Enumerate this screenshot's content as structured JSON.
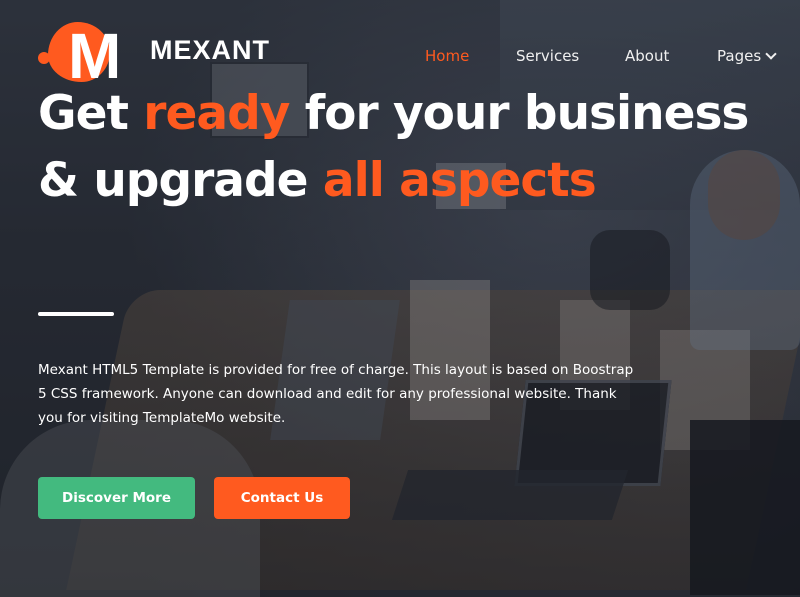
{
  "brand": {
    "name": "MEXANT",
    "mark_letter": "M",
    "accent_color": "#ff5a1f"
  },
  "nav": {
    "items": [
      {
        "label": "Home",
        "active": true
      },
      {
        "label": "Services"
      },
      {
        "label": "About"
      },
      {
        "label": "Pages",
        "icon": "chevron-down-icon"
      }
    ]
  },
  "hero": {
    "headline": {
      "part1": "Get ",
      "highlight1": "ready",
      "part2": " for your business",
      "part3": "& upgrade ",
      "highlight2": "all aspects"
    },
    "description": "Mexant HTML5 Template is provided for free of charge. This layout is based on Boostrap 5 CSS framework. Anyone can download and edit for any professional website. Thank you for visiting TemplateMo website.",
    "buttons": {
      "primary": {
        "label": "Discover More",
        "color": "#43ba7f"
      },
      "secondary": {
        "label": "Contact Us",
        "color": "#ff5a1f"
      }
    }
  }
}
